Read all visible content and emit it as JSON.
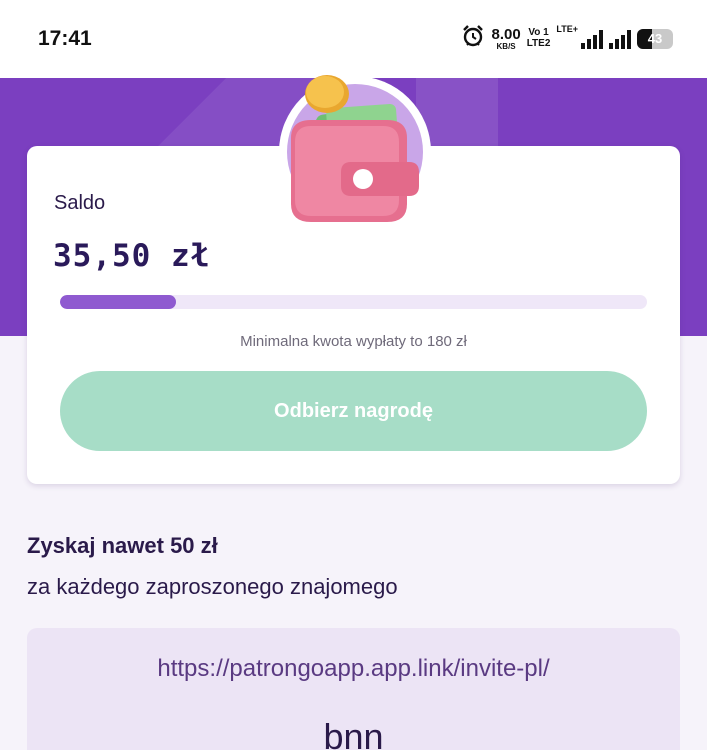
{
  "status_bar": {
    "time": "17:41",
    "net_speed_value": "8.00",
    "net_speed_unit": "KB/S",
    "volte_top": "Vo 1",
    "volte_bottom": "LTE2",
    "lte_label": "LTE+",
    "battery_level": "43",
    "icons": [
      "alarm-icon",
      "signal-icon",
      "battery-icon"
    ]
  },
  "balance_card": {
    "label": "Saldo",
    "amount": "35,50 zł",
    "progress_fraction": 0.197,
    "min_note": "Minimalna kwota wypłaty to 180 zł",
    "claim_button": "Odbierz nagrodę"
  },
  "invite": {
    "title": "Zyskaj nawet 50 zł",
    "subtitle": "za każdego zaproszonego znajomego",
    "link": "https://patrongoapp.app.link/invite-pl/",
    "code": "bnn"
  },
  "colors": {
    "brand_purple": "#7b3fc0",
    "progress": "#8f5ad0",
    "button_green": "#a7ddc7",
    "text_dark": "#2a1a4a"
  }
}
